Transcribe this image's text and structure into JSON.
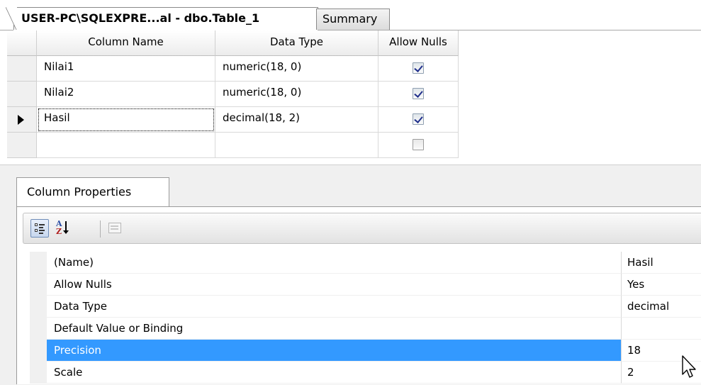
{
  "tabs": {
    "active_label": "USER-PC\\SQLEXPRE...al - dbo.Table_1",
    "summary_label": "Summary"
  },
  "grid": {
    "headers": [
      "Column Name",
      "Data Type",
      "Allow Nulls"
    ],
    "rows": [
      {
        "name": "Nilai1",
        "type": "numeric(18, 0)",
        "allow_nulls": true
      },
      {
        "name": "Nilai2",
        "type": "numeric(18, 0)",
        "allow_nulls": true
      },
      {
        "name": "Hasil",
        "type": "decimal(18, 2)",
        "allow_nulls": true
      },
      {
        "name": "",
        "type": "",
        "allow_nulls": false
      }
    ]
  },
  "column_properties": {
    "tab_label": "Column Properties",
    "toolbar": {
      "categorized_icon": "categorized-icon",
      "alphabetical_icon": "sort-az-icon",
      "property_pages_icon": "property-pages-icon"
    },
    "properties": [
      {
        "name": "(Name)",
        "value": "Hasil"
      },
      {
        "name": "Allow Nulls",
        "value": "Yes"
      },
      {
        "name": "Data Type",
        "value": "decimal"
      },
      {
        "name": "Default Value or Binding",
        "value": ""
      },
      {
        "name": "Precision",
        "value": "18"
      },
      {
        "name": "Scale",
        "value": "2"
      }
    ],
    "selected_property": "Precision"
  },
  "colors": {
    "selection": "#3399ff",
    "checkbox_mark": "#21308c"
  }
}
